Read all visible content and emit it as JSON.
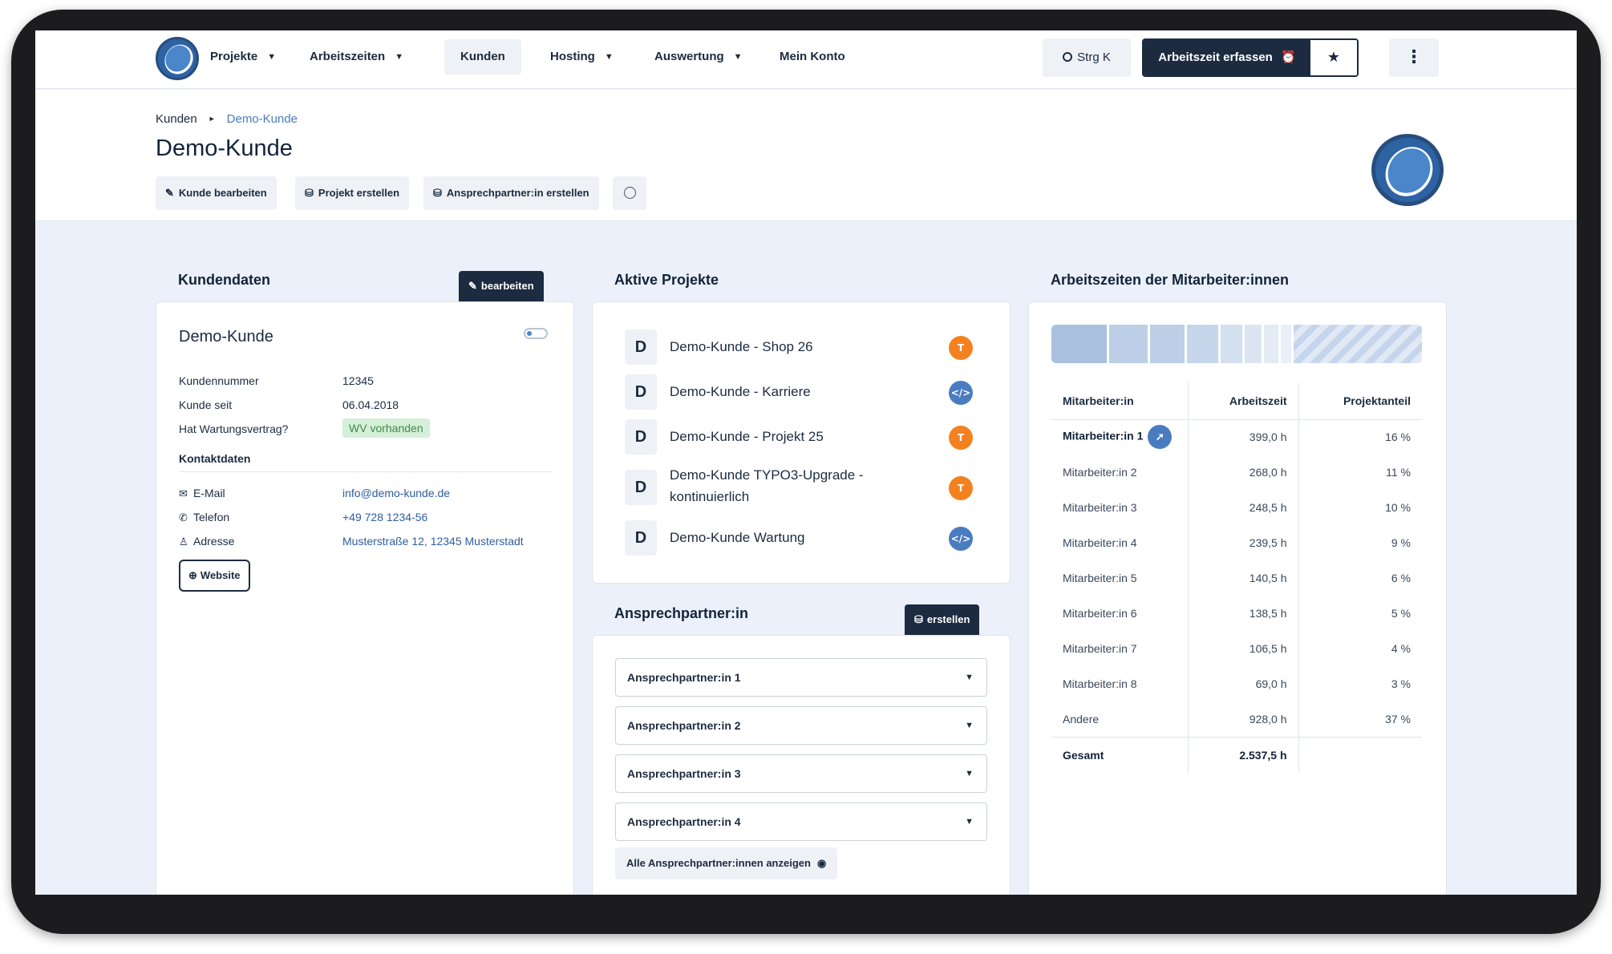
{
  "nav": {
    "items": [
      {
        "label": "Projekte",
        "caret": true
      },
      {
        "label": "Arbeitszeiten",
        "caret": true
      },
      {
        "label": "Kunden",
        "caret": false,
        "active": true
      },
      {
        "label": "Hosting",
        "caret": true
      },
      {
        "label": "Auswertung",
        "caret": true
      },
      {
        "label": "Mein Konto",
        "caret": false
      }
    ],
    "search_label": "Strg K",
    "record_label": "Arbeitszeit erfassen"
  },
  "breadcrumb": {
    "root": "Kunden",
    "current": "Demo-Kunde"
  },
  "page_title": "Demo-Kunde",
  "actions": {
    "edit": "Kunde bearbeiten",
    "new_project": "Projekt erstellen",
    "new_contact": "Ansprechpartner:in erstellen"
  },
  "kundendaten": {
    "title": "Kundendaten",
    "edit_label": "bearbeiten",
    "name": "Demo-Kunde",
    "rows": [
      {
        "key": "Kundennummer",
        "value": "12345"
      },
      {
        "key": "Kunde seit",
        "value": "06.04.2018"
      },
      {
        "key": "Hat Wartungsvertrag?",
        "value": "WV vorhanden"
      }
    ],
    "contacts_title": "Kontaktdaten",
    "contacts": [
      {
        "icon": "envelope-icon",
        "key": "E-Mail",
        "value": "info@demo-kunde.de"
      },
      {
        "icon": "phone-icon",
        "key": "Telefon",
        "value": "+49 728 1234-56"
      },
      {
        "icon": "person-icon",
        "key": "Adresse",
        "value": "Musterstraße 12, 12345 Musterstadt"
      }
    ],
    "website_label": "Website"
  },
  "projects": {
    "title": "Aktive Projekte",
    "items": [
      {
        "letter": "D",
        "name": "Demo-Kunde - Shop 26",
        "icon": "typo3-icon"
      },
      {
        "letter": "D",
        "name": "Demo-Kunde - Karriere",
        "icon": "code-icon"
      },
      {
        "letter": "D",
        "name": "Demo-Kunde - Projekt 25",
        "icon": "typo3-icon"
      },
      {
        "letter": "D",
        "name": "Demo-Kunde TYPO3-Upgrade - kontinuierlich",
        "icon": "typo3-icon"
      },
      {
        "letter": "D",
        "name": "Demo-Kunde Wartung",
        "icon": "code-icon"
      }
    ]
  },
  "contacts_section": {
    "title": "Ansprechpartner:in",
    "create_label": "erstellen",
    "items": [
      "Ansprechpartner:in 1",
      "Ansprechpartner:in 2",
      "Ansprechpartner:in 3",
      "Ansprechpartner:in 4"
    ],
    "show_all_label": "Alle Ansprechpartner:innen anzeigen"
  },
  "worktime": {
    "title": "Arbeitszeiten der Mitarbeiter:innen",
    "headers": [
      "Mitarbeiter:in",
      "Arbeitszeit",
      "Projektanteil"
    ],
    "rows": [
      {
        "name": "Mitarbeiter:in 1",
        "hours": "399,0 h",
        "share": "16 %"
      },
      {
        "name": "Mitarbeiter:in 2",
        "hours": "268,0 h",
        "share": "11 %"
      },
      {
        "name": "Mitarbeiter:in 3",
        "hours": "248,5 h",
        "share": "10 %"
      },
      {
        "name": "Mitarbeiter:in 4",
        "hours": "239,5 h",
        "share": "9 %"
      },
      {
        "name": "Mitarbeiter:in 5",
        "hours": "140,5 h",
        "share": "6 %"
      },
      {
        "name": "Mitarbeiter:in 6",
        "hours": "138,5 h",
        "share": "5 %"
      },
      {
        "name": "Mitarbeiter:in 7",
        "hours": "106,5 h",
        "share": "4 %"
      },
      {
        "name": "Mitarbeiter:in 8",
        "hours": "69,0 h",
        "share": "3 %"
      },
      {
        "name": "Andere",
        "hours": "928,0 h",
        "share": "37 %"
      }
    ],
    "total_label": "Gesamt",
    "total_hours": "2.537,5 h",
    "bar_shares": [
      16,
      11,
      10,
      9,
      6,
      5,
      4,
      3,
      37
    ],
    "bar_colors": [
      "#a9c1df",
      "#bccfe6",
      "#bccfe6",
      "#c6d6ea",
      "#d3e0f0",
      "#dbe5f2",
      "#e3ebf5",
      "#eaf0f8"
    ]
  }
}
